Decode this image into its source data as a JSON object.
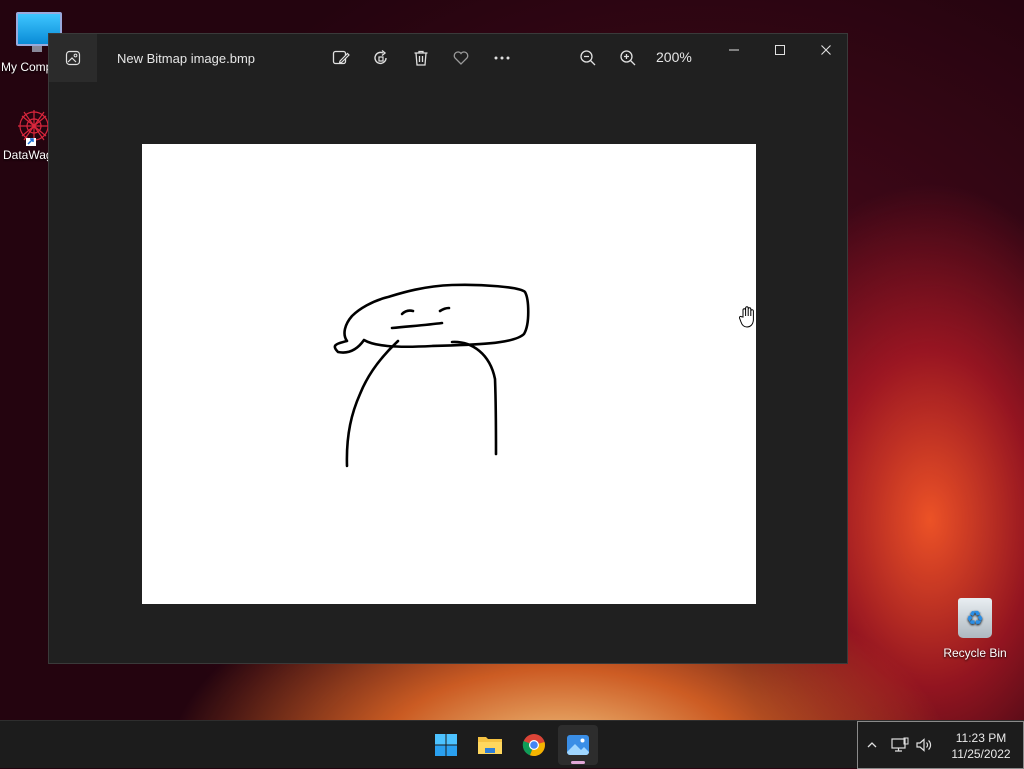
{
  "desktop": {
    "icons": [
      {
        "label": "My Computer"
      },
      {
        "label": "DataWag"
      },
      {
        "label": "Recycle Bin"
      }
    ]
  },
  "window": {
    "title": "New Bitmap image.bmp",
    "zoom": "200%",
    "toolbar": {
      "edit": "edit-image-icon",
      "rotate": "rotate-icon",
      "delete": "delete-icon",
      "favorite": "heart-icon",
      "more": "more-icon",
      "zoom_out": "zoom-out-icon",
      "zoom_in": "zoom-in-icon"
    },
    "controls": [
      "minimize",
      "maximize",
      "close"
    ]
  },
  "taskbar": {
    "apps": [
      "start",
      "file-explorer",
      "chrome",
      "photos"
    ],
    "active_app": "photos",
    "clock_time": "11:23 PM",
    "clock_date": "11/25/2022"
  },
  "colors": {
    "window_bg": "#202020",
    "taskbar_bg": "#1c1c1c",
    "canvas": "#ffffff"
  }
}
